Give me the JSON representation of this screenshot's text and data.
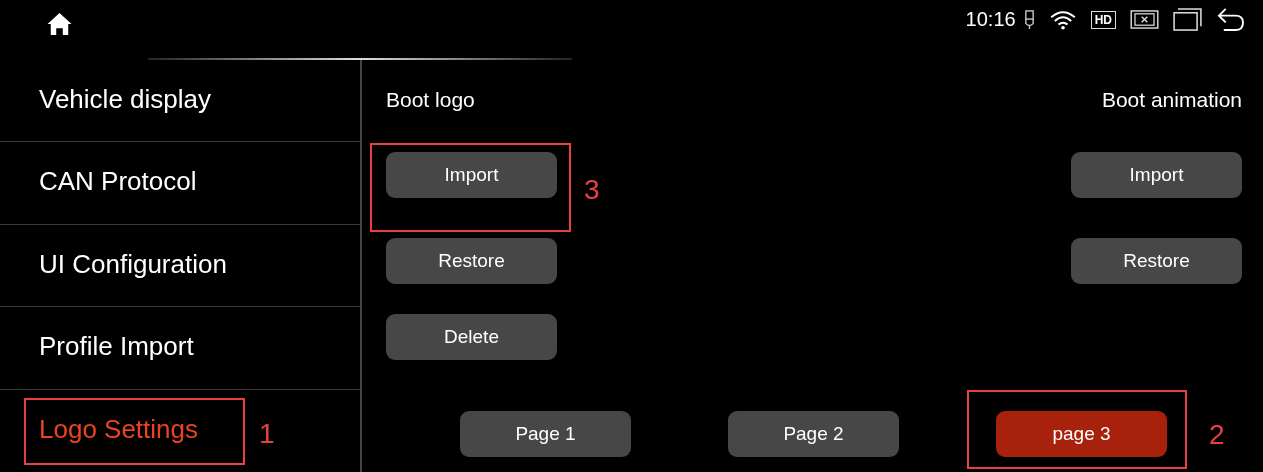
{
  "status_bar": {
    "time": "10:16",
    "hd_label": "HD"
  },
  "sidebar": {
    "items": [
      {
        "label": "Vehicle display",
        "selected": false
      },
      {
        "label": "CAN Protocol",
        "selected": false
      },
      {
        "label": "UI Configuration",
        "selected": false
      },
      {
        "label": "Profile Import",
        "selected": false
      },
      {
        "label": "Logo Settings",
        "selected": true
      }
    ]
  },
  "boot_logo": {
    "title": "Boot logo",
    "buttons": [
      "Import",
      "Restore",
      "Delete"
    ]
  },
  "boot_animation": {
    "title": "Boot animation",
    "buttons": [
      "Import",
      "Restore"
    ]
  },
  "pages": [
    {
      "label": "Page 1",
      "selected": false
    },
    {
      "label": "Page 2",
      "selected": false
    },
    {
      "label": "page 3",
      "selected": true
    }
  ],
  "annotations": [
    {
      "label": "1",
      "kind": "sidebar"
    },
    {
      "label": "2",
      "kind": "pager"
    },
    {
      "label": "3",
      "kind": "import"
    }
  ]
}
